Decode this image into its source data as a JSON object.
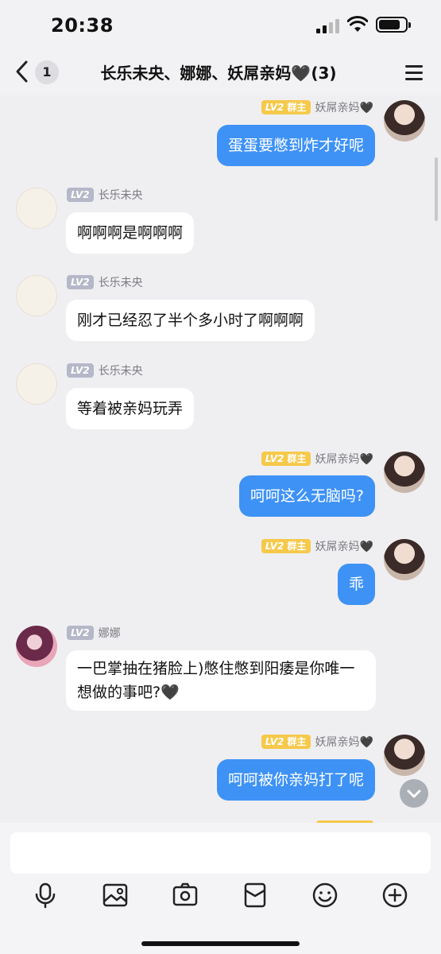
{
  "status_bar": {
    "time": "20:38"
  },
  "nav": {
    "unread_count": "1",
    "title": "长乐未央、娜娜、妖屌亲妈🖤(3)"
  },
  "badges": {
    "lv": "LV2",
    "owner": "群主"
  },
  "messages": [
    {
      "side": "right",
      "sender": "妖屌亲妈🖤",
      "owner": true,
      "text": "蛋蛋要憋到炸才好呢"
    },
    {
      "side": "left",
      "sender": "长乐未央",
      "owner": false,
      "text": "啊啊啊是啊啊啊"
    },
    {
      "side": "left",
      "sender": "长乐未央",
      "owner": false,
      "text": "刚才已经忍了半个多小时了啊啊啊"
    },
    {
      "side": "left",
      "sender": "长乐未央",
      "owner": false,
      "text": "等着被亲妈玩弄"
    },
    {
      "side": "right",
      "sender": "妖屌亲妈🖤",
      "owner": true,
      "text": "呵呵这么无脑吗?"
    },
    {
      "side": "right",
      "sender": "妖屌亲妈🖤",
      "owner": true,
      "text": "乖"
    },
    {
      "side": "left",
      "sender": "娜娜",
      "owner": false,
      "text": "一巴掌抽在猪脸上)憋住憋到阳痿是你唯一想做的事吧?🖤"
    },
    {
      "side": "right",
      "sender": "妖屌亲妈🖤",
      "owner": true,
      "text": "呵呵被你亲妈打了呢"
    }
  ],
  "input": {
    "placeholder": ""
  },
  "toolbar": [
    {
      "name": "microphone-icon"
    },
    {
      "name": "image-icon"
    },
    {
      "name": "camera-icon"
    },
    {
      "name": "red-packet-icon"
    },
    {
      "name": "emoji-icon"
    },
    {
      "name": "plus-icon"
    }
  ],
  "colors": {
    "bubble_right": "#3e92f5",
    "bubble_left": "#ffffff",
    "background": "#efeff2",
    "lv_gray": "#b5b8c8",
    "owner_gold": "#f6c94a"
  }
}
